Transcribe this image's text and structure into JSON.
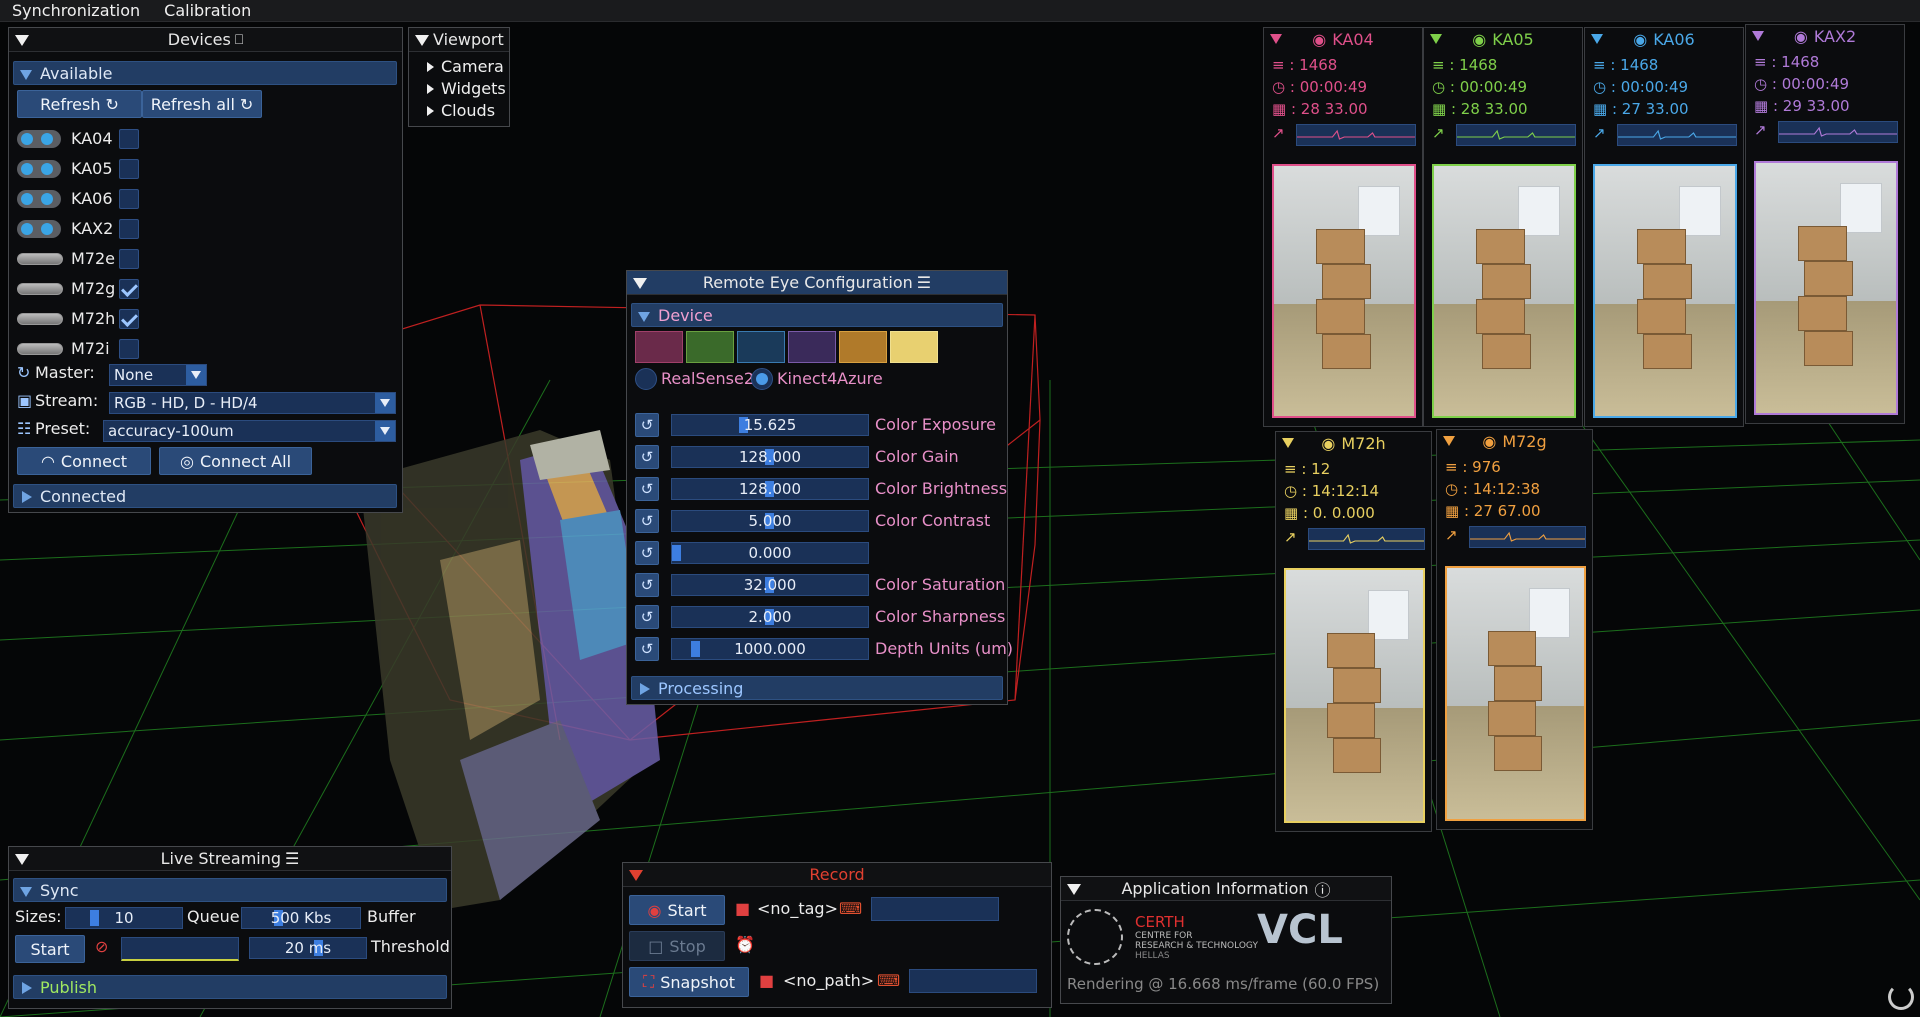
{
  "menu": {
    "items": [
      "Synchronization",
      "Calibration"
    ]
  },
  "devices": {
    "title": "Devices",
    "available_label": "Available",
    "refresh_label": "Refresh",
    "refresh_all_label": "Refresh all",
    "list": [
      {
        "name": "KA04",
        "type": "toggle",
        "checked": false
      },
      {
        "name": "KA05",
        "type": "toggle",
        "checked": false
      },
      {
        "name": "KA06",
        "type": "toggle",
        "checked": false
      },
      {
        "name": "KAX2",
        "type": "toggle",
        "checked": false
      },
      {
        "name": "M72e",
        "type": "kinect",
        "checked": false
      },
      {
        "name": "M72g",
        "type": "kinect",
        "checked": true
      },
      {
        "name": "M72h",
        "type": "kinect",
        "checked": true
      },
      {
        "name": "M72i",
        "type": "kinect",
        "checked": false
      }
    ],
    "master_label": "Master:",
    "master_value": "None",
    "stream_label": "Stream:",
    "stream_value": "RGB - HD, D - HD/4",
    "preset_label": "Preset:",
    "preset_value": "accuracy-100um",
    "connect_label": "Connect",
    "connect_all_label": "Connect All",
    "connected_label": "Connected"
  },
  "viewport": {
    "title": "Viewport",
    "items": [
      "Camera",
      "Widgets",
      "Clouds"
    ]
  },
  "remote": {
    "title": "Remote Eye Configuration",
    "device_label": "Device",
    "radio1": "RealSense2",
    "radio2": "Kinect4Azure",
    "params": [
      {
        "value": "15.625",
        "label": "Color Exposure",
        "fraction": 0.36
      },
      {
        "value": "128.000",
        "label": "Color Gain",
        "fraction": 0.5
      },
      {
        "value": "128.000",
        "label": "Color Brightness",
        "fraction": 0.5
      },
      {
        "value": "5.000",
        "label": "Color Contrast",
        "fraction": 0.5
      },
      {
        "value": "0.000",
        "label": "",
        "fraction": 0.0
      },
      {
        "value": "32.000",
        "label": "Color Saturation",
        "fraction": 0.5
      },
      {
        "value": "2.000",
        "label": "Color Sharpness",
        "fraction": 0.5
      },
      {
        "value": "1000.000",
        "label": "Depth Units (um)",
        "fraction": 0.1
      }
    ],
    "processing_label": "Processing"
  },
  "cams": [
    {
      "name": "KA04",
      "color": "#e0508a",
      "frames": "1468",
      "time": "00:00:49",
      "fps": "28  33.00"
    },
    {
      "name": "KA05",
      "color": "#7fd04a",
      "frames": "1468",
      "time": "00:00:49",
      "fps": "28  33.00"
    },
    {
      "name": "KA06",
      "color": "#4aa8e8",
      "frames": "1468",
      "time": "00:00:49",
      "fps": "27  33.00"
    },
    {
      "name": "KAX2",
      "color": "#b07ad8",
      "frames": "1468",
      "time": "00:00:49",
      "fps": "29  33.00"
    },
    {
      "name": "M72h",
      "color": "#e8d060",
      "frames": "12",
      "time": "14:12:14",
      "fps": "0.  0.000"
    },
    {
      "name": "M72g",
      "color": "#f0a040",
      "frames": "976",
      "time": "14:12:38",
      "fps": "27  67.00"
    }
  ],
  "live": {
    "title": "Live Streaming",
    "sync_label": "Sync",
    "sizes_label": "Sizes:",
    "sizes_value": "10",
    "queue_label": "Queue",
    "buffer_value": "500 Kbs",
    "buffer_label": "Buffer",
    "start_label": "Start",
    "threshold_value": "20 ms",
    "threshold_label": "Threshold",
    "publish_label": "Publish"
  },
  "record": {
    "title": "Record",
    "start_label": "Start",
    "stop_label": "Stop",
    "snapshot_label": "Snapshot",
    "tag_value": "<no_tag>",
    "path_value": "<no_path>"
  },
  "appinfo": {
    "title": "Application Information",
    "org_name": "CERTH",
    "org_sub1": "CENTRE FOR",
    "org_sub2": "RESEARCH & TECHNOLOGY",
    "org_sub3": "HELLAS",
    "lab": "VCL",
    "rendering": "Rendering @ 16.668 ms/frame (60.0 FPS)"
  }
}
